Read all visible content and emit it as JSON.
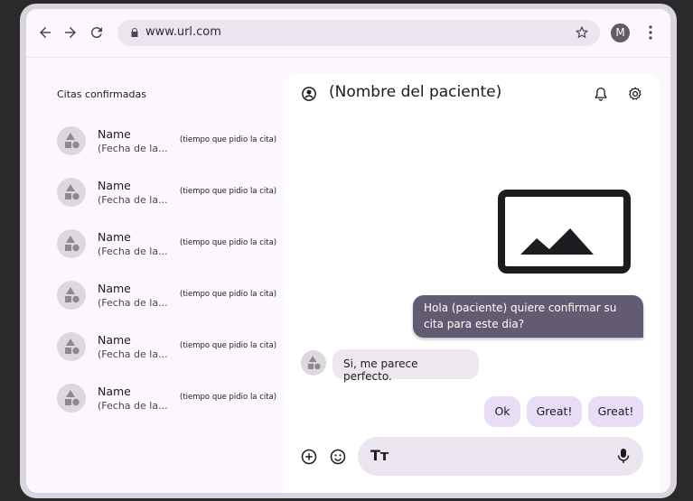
{
  "browser": {
    "url": "www.url.com",
    "profile_initial": "M",
    "icons": [
      "back-icon",
      "forward-icon",
      "reload-icon",
      "lock-icon",
      "star-icon",
      "more-vert-icon"
    ]
  },
  "sidebar": {
    "title": "Citas confirmadas",
    "items": [
      {
        "name": "Name",
        "subtitle": "(Fecha de la...",
        "time": "(tiempo que pidio la cita)"
      },
      {
        "name": "Name",
        "subtitle": "(Fecha de la...",
        "time": "(tiempo que pidio la cita)"
      },
      {
        "name": "Name",
        "subtitle": "(Fecha de la...",
        "time": "(tiempo que pidio la cita)"
      },
      {
        "name": "Name",
        "subtitle": "(Fecha de la...",
        "time": "(tiempo que pidio la cita)"
      },
      {
        "name": "Name",
        "subtitle": "(Fecha de la...",
        "time": "(tiempo que pidio la cita)"
      },
      {
        "name": "Name",
        "subtitle": "(Fecha de la...",
        "time": "(tiempo que pidio la cita)"
      }
    ]
  },
  "chat": {
    "patient_name": "(Nombre del paciente)",
    "outgoing_message": "Hola (paciente) quiere confirmar su cita para este dia?",
    "incoming_message": "Si, me parece perfecto.",
    "quick_replies": [
      "Ok",
      "Great!",
      "Great!"
    ],
    "composer_icon_text": "Tт"
  },
  "colors": {
    "outgoing_bubble": "#625b71",
    "chip": "#e7def6",
    "surface": "#fcf6fd"
  }
}
